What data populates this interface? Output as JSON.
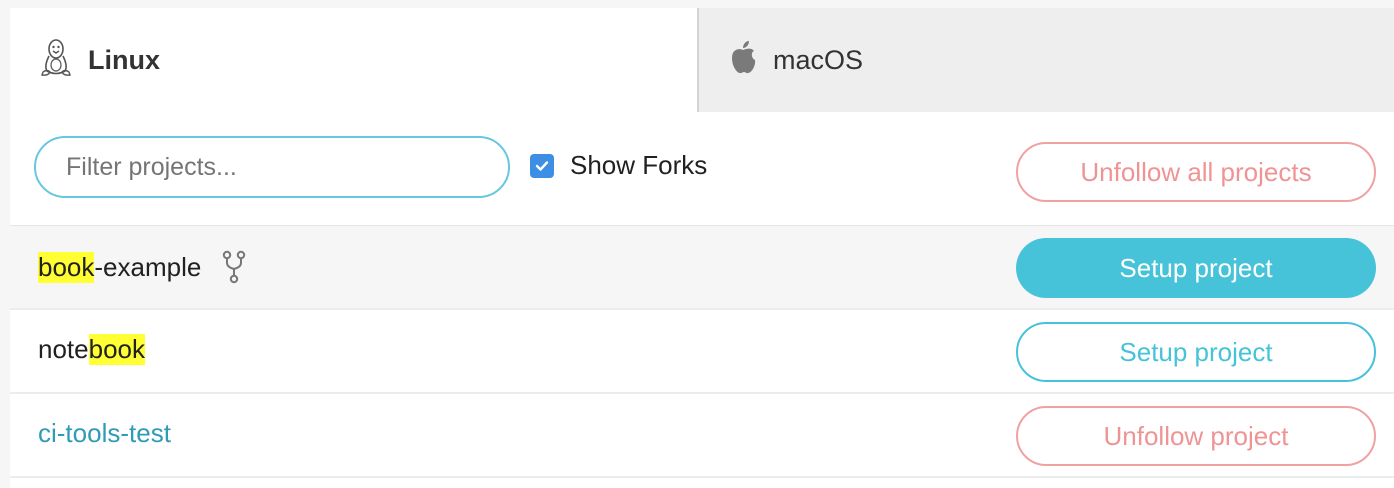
{
  "tabs": [
    {
      "label": "Linux",
      "icon": "linux-penguin-icon",
      "active": true
    },
    {
      "label": "macOS",
      "icon": "apple-icon",
      "active": false
    }
  ],
  "filter": {
    "placeholder": "Filter projects...",
    "value": ""
  },
  "show_forks": {
    "label": "Show Forks",
    "checked": true
  },
  "unfollow_all_label": "Unfollow all projects",
  "projects": [
    {
      "prefix": "",
      "highlight": "book",
      "suffix": "-example",
      "is_fork": true,
      "fork_icon": "fork-icon",
      "action": "Setup project"
    },
    {
      "prefix": "note",
      "highlight": "book",
      "suffix": "",
      "is_fork": false,
      "action": "Setup project"
    },
    {
      "name": "ci-tools-test",
      "action": "Unfollow project"
    }
  ],
  "colors": {
    "accent": "#46c3d9",
    "danger": "#ef9494",
    "highlight": "#ffff33",
    "checkbox": "#3d8fe5"
  }
}
